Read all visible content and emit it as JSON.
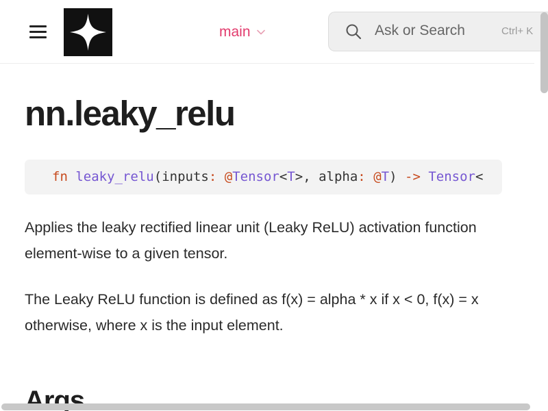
{
  "header": {
    "menu_icon": "hamburger-menu-icon",
    "logo_icon": "four-point-star-logo",
    "branch": "main",
    "search_placeholder": "Ask or Search",
    "search_shortcut": "Ctrl+ K"
  },
  "page": {
    "title": "nn.leaky_relu",
    "signature": {
      "kw": "fn",
      "name": "leaky_relu",
      "p_open": "(",
      "arg1": "inputs",
      "colon1": ":",
      "at1": "@",
      "type1": "Tensor",
      "lt1": "<",
      "tparam1": "T",
      "gt1": ">",
      "comma": ", ",
      "arg2": "alpha",
      "colon2": ":",
      "at2": "@",
      "tparam2": "T",
      "p_close": ")",
      "arrow": "->",
      "ret_type": "Tensor",
      "lt2": "<"
    },
    "description": "Applies the leaky rectified linear unit (Leaky ReLU) activation function element-wise to a given tensor.",
    "definition": "The Leaky ReLU function is defined as f(x) = alpha * x if x < 0, f(x) = x otherwise, where x is the input element.",
    "args_heading": "Args"
  },
  "colors": {
    "branch": "#e23b6d",
    "keyword": "#c74a1d",
    "identifier": "#7556d2"
  }
}
